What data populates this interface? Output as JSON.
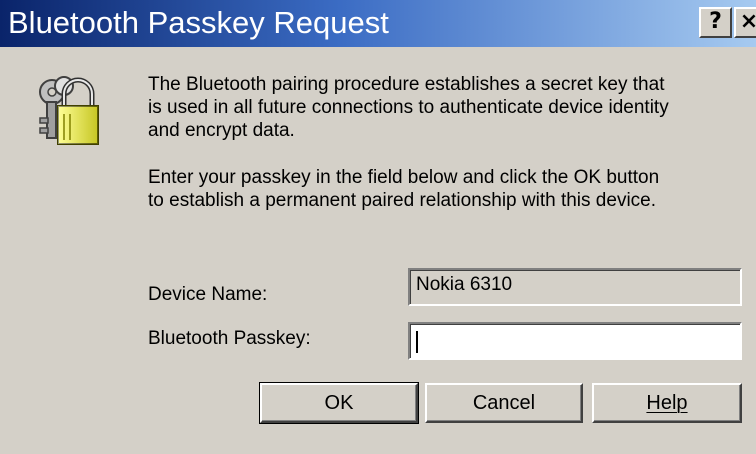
{
  "window": {
    "title": "Bluetooth Passkey Request",
    "help_button": "?",
    "close_button": "×"
  },
  "icon": "keys-and-padlock-icon",
  "message": {
    "paragraph1": [
      "The Bluetooth pairing procedure establishes a secret key that",
      "is used in all future connections to authenticate device identity",
      "and encrypt data."
    ],
    "paragraph2": [
      "Enter your passkey in the field below and click the OK button",
      "to establish a permanent paired relationship with this device."
    ]
  },
  "form": {
    "device_name_label": "Device Name:",
    "device_name_value": "Nokia 6310",
    "passkey_label": "Bluetooth Passkey:",
    "passkey_value": ""
  },
  "buttons": {
    "ok": "OK",
    "cancel": "Cancel",
    "help": "Help"
  },
  "colors": {
    "title_gradient_start": "#0a246a",
    "title_gradient_end": "#a6caf0",
    "face": "#d4d0c8"
  }
}
